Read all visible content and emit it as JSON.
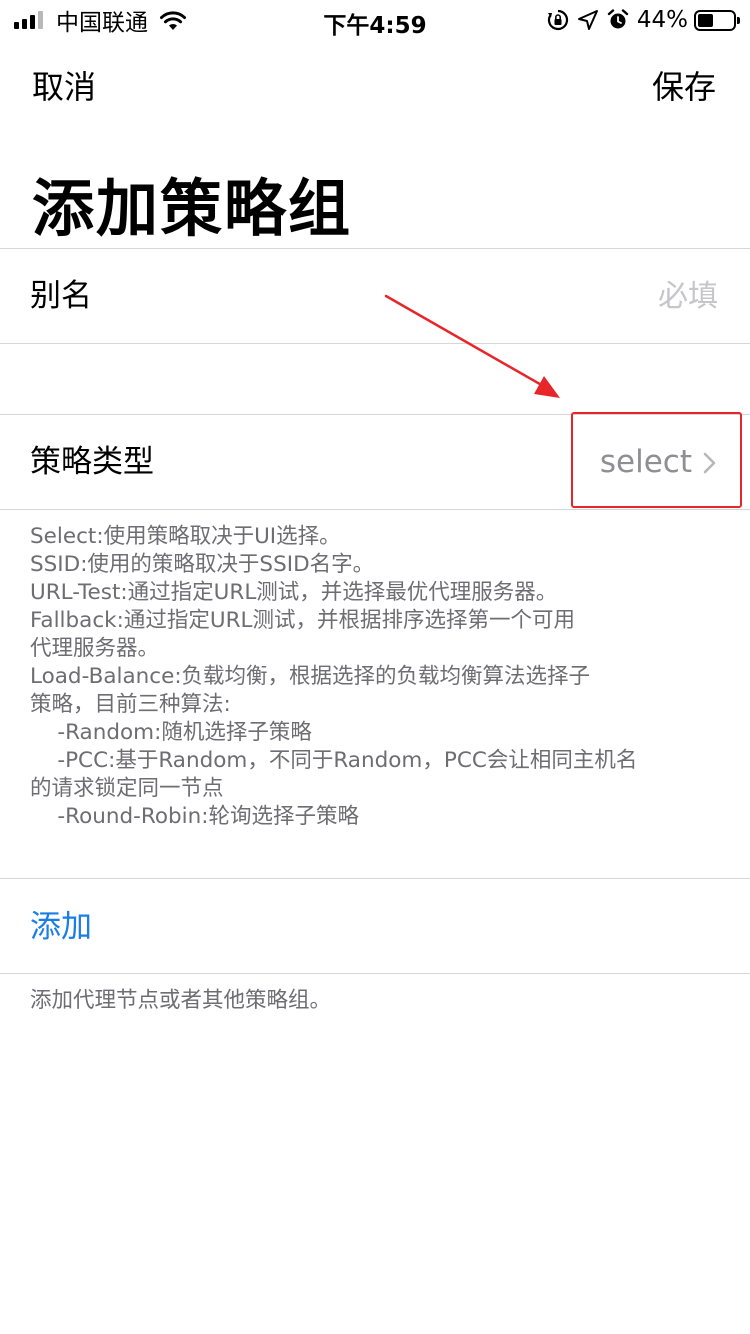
{
  "status_bar": {
    "carrier": "中国联通",
    "time": "下午4:59",
    "battery_percent": "44%",
    "battery_level": 0.44
  },
  "nav": {
    "cancel_label": "取消",
    "save_label": "保存"
  },
  "page_title": "添加策略组",
  "alias_row": {
    "label": "别名",
    "placeholder": "必填"
  },
  "policy_type_row": {
    "label": "策略类型",
    "value": "select"
  },
  "policy_type_help": [
    "Select:使用策略取决于UI选择。",
    "SSID:使用的策略取决于SSID名字。",
    "URL-Test:通过指定URL测试，并选择最优代理服务器。",
    "Fallback:通过指定URL测试，并根据排序选择第一个可用",
    "代理服务器。",
    "Load-Balance:负载均衡，根据选择的负载均衡算法选择子",
    "策略，目前三种算法:",
    "    -Random:随机选择子策略",
    "    -PCC:基于Random，不同于Random，PCC会让相同主机名",
    "的请求锁定同一节点",
    "    -Round-Robin:轮询选择子策略"
  ],
  "add_row": {
    "label": "添加",
    "help": "添加代理节点或者其他策略组。"
  },
  "colors": {
    "accent": "#1a7ee8",
    "annotation": "#e8262a",
    "secondary_text": "#8e8e93",
    "placeholder": "#c5c5ca"
  }
}
